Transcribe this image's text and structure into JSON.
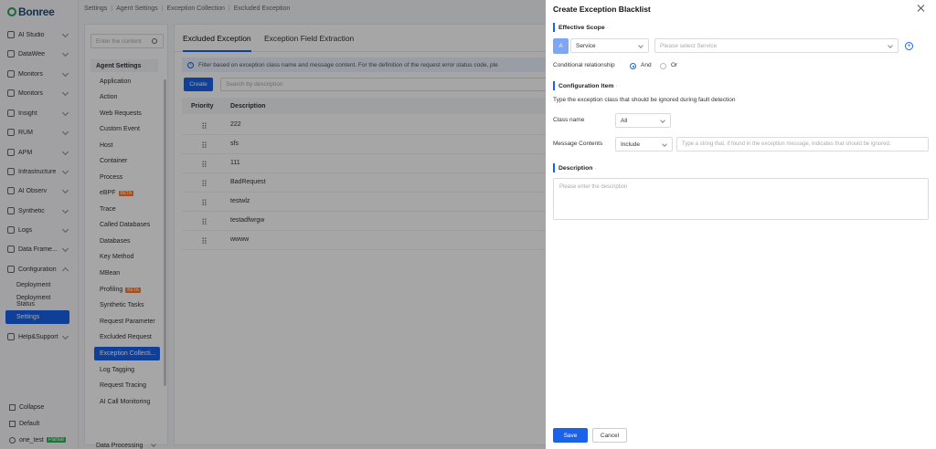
{
  "nav": {
    "brand": "Bonree",
    "items": [
      {
        "label": "AI Studio",
        "icon": "ai-studio-icon"
      },
      {
        "label": "DataWee",
        "icon": "datawee-icon"
      },
      {
        "label": "Monitors",
        "icon": "monitors-icon"
      },
      {
        "label": "Monitors",
        "icon": "monitors-icon"
      },
      {
        "label": "Insight",
        "icon": "insight-icon"
      },
      {
        "label": "RUM",
        "icon": "rum-icon"
      },
      {
        "label": "APM",
        "icon": "apm-icon"
      },
      {
        "label": "Infrastructure",
        "icon": "infrastructure-icon"
      },
      {
        "label": "AI Observ",
        "icon": "ai-observ-icon"
      },
      {
        "label": "Synthetic",
        "icon": "synthetic-icon"
      },
      {
        "label": "Logs",
        "icon": "logs-icon"
      },
      {
        "label": "Data Frame...",
        "icon": "data-frame-icon"
      },
      {
        "label": "Configuration",
        "icon": "configuration-icon"
      }
    ],
    "sub_items": [
      "Deployment",
      "Deployment Status",
      "Settings"
    ],
    "help": "Help&Support",
    "collapse": "Collapse",
    "default": "Default",
    "user": "one_test",
    "user_badge": "Partial"
  },
  "breadcrumb": [
    "Settings",
    "Agent Settings",
    "Exception Collection",
    "Excluded Exception"
  ],
  "subpanel": {
    "search_placeholder": "Enter the content",
    "group": "Agent Settings",
    "items": [
      "Application",
      "Action",
      "Web Requests",
      "Custom Event",
      "Host",
      "Container",
      "Process",
      "eBPF",
      "Trace",
      "Called Databases",
      "Databases",
      "Key Method",
      "MBean",
      "Profiling",
      "Synthetic Tasks",
      "Request Parameter",
      "Excluded Request",
      "Exception Collecti...",
      "Log Tagging",
      "Request Tracing",
      "AI Call Monitoring"
    ],
    "beta_label": "BETA",
    "footer": "Data Processing"
  },
  "main": {
    "tabs": [
      "Excluded Exception",
      "Exception Field Extraction"
    ],
    "info": "Filter based on exception class name and message content. For the definition of the request error status code, ple",
    "create_label": "Create",
    "search_placeholder": "Search by description",
    "columns": [
      "Priority",
      "Description"
    ],
    "rows": [
      "222",
      "sfs",
      "111",
      "BadRequest",
      "testwlz",
      "testadfwrgw",
      "wwww"
    ]
  },
  "drawer": {
    "title": "Create Exception Blacklist",
    "effective_scope": "Effective Scope",
    "scope_tag": "A",
    "scope_type": "Service",
    "service_placeholder": "Please select Service",
    "conditional_label": "Conditional relationship",
    "and_label": "And",
    "or_label": "Or",
    "config_item": "Configuration Item",
    "config_hint": "Type the exception class that should be ignored during fault detection",
    "class_name_label": "Class name",
    "class_name_value": "All",
    "message_label": "Message Contents",
    "message_value": "Include",
    "message_placeholder": "Type a string that, if found in the exception message, indicates that should be ignored.",
    "description_label": "Description",
    "description_placeholder": "Please enter the description",
    "save_label": "Save",
    "cancel_label": "Cancel"
  },
  "colors": {
    "accent": "#1a62e8",
    "beta": "#ff7a2f",
    "partial": "#2fb45a"
  }
}
